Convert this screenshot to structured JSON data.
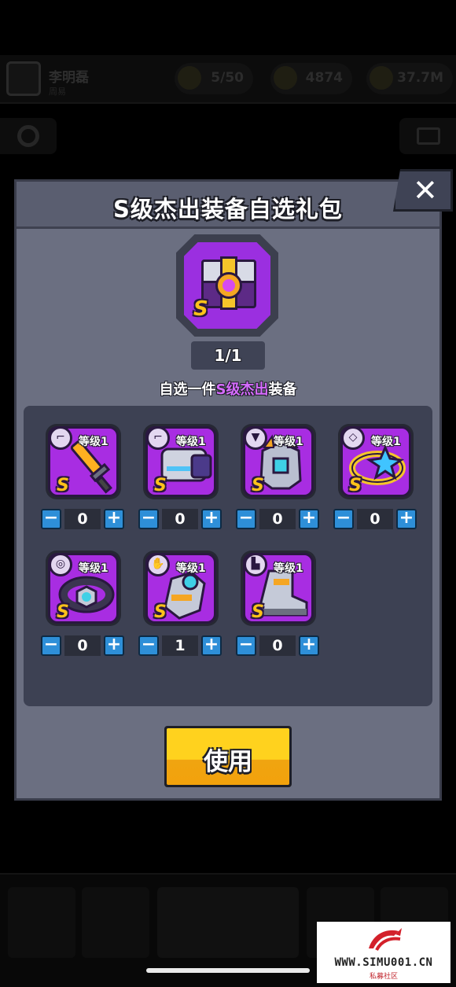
{
  "background": {
    "player_name": "李明磊",
    "player_sub": "周易",
    "resources": [
      "5/50",
      "4874",
      "37.7M"
    ]
  },
  "dialog": {
    "title": "S级杰出装备自选礼包",
    "close_label": "✕",
    "count": "1/1",
    "subtitle_prefix": "自选一件",
    "subtitle_highlight": "S级杰出",
    "subtitle_suffix": "装备",
    "grade_letter": "S",
    "use_label": "使用"
  },
  "items": [
    {
      "slot": "weapon",
      "badge_icon": "gun-icon",
      "badge": "⌐",
      "level": "等级1",
      "grade": "S",
      "count": "0",
      "art": "sword"
    },
    {
      "slot": "weapon",
      "badge_icon": "gun-icon",
      "badge": "⌐",
      "level": "等级1",
      "grade": "S",
      "count": "0",
      "art": "gauntlet-gun"
    },
    {
      "slot": "armor",
      "badge_icon": "shirt-icon",
      "badge": "▼",
      "level": "等级1",
      "grade": "S",
      "count": "0",
      "art": "armor"
    },
    {
      "slot": "ring",
      "badge_icon": "ring-icon",
      "badge": "◇",
      "level": "等级1",
      "grade": "S",
      "count": "0",
      "art": "ring"
    },
    {
      "slot": "belt",
      "badge_icon": "belt-icon",
      "badge": "◎",
      "level": "等级1",
      "grade": "S",
      "count": "0",
      "art": "belt"
    },
    {
      "slot": "glove",
      "badge_icon": "glove-icon",
      "badge": "✋",
      "level": "等级1",
      "grade": "S",
      "count": "1",
      "art": "glove"
    },
    {
      "slot": "boots",
      "badge_icon": "boot-icon",
      "badge": "▙",
      "level": "等级1",
      "grade": "S",
      "count": "0",
      "art": "boot"
    }
  ],
  "stepper": {
    "minus": "−",
    "plus": "+"
  },
  "watermark": {
    "text": "WWW.SIMU001.CN",
    "sub": "私募社区"
  },
  "colors": {
    "card": "#a82de2",
    "accent_blue": "#2e8fd8",
    "button_yellow": "#ffd21e",
    "highlight": "#d66cff"
  }
}
